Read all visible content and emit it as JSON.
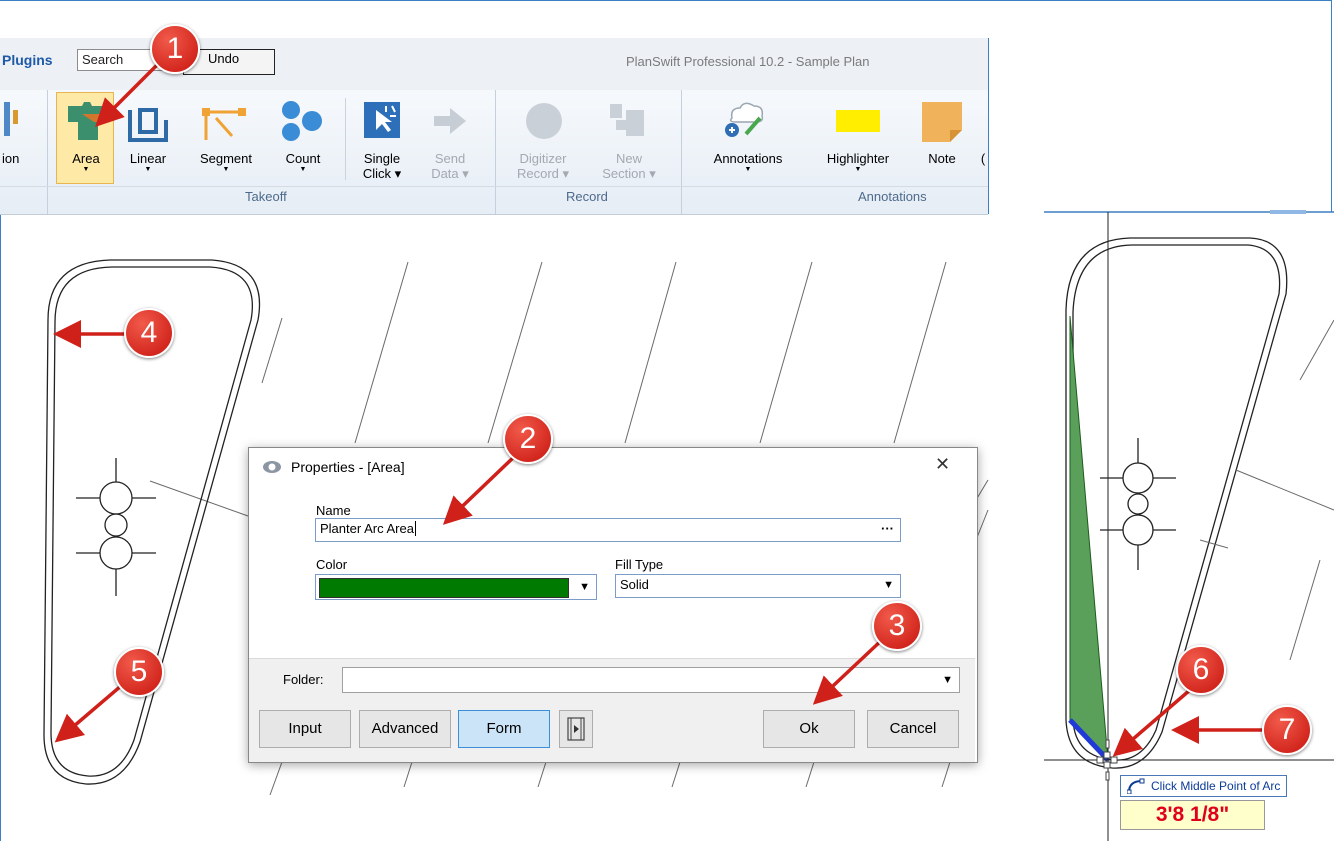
{
  "ribbon": {
    "tab_label": "Plugins",
    "search_placeholder": "Search",
    "undo_label": "Undo",
    "app_title": "PlanSwift Professional 10.2 - Sample Plan",
    "partial_label": "ion",
    "takeoff_group": "Takeoff",
    "record_group": "Record",
    "annotations_group": "Annotations",
    "buttons": {
      "area": "Area",
      "linear": "Linear",
      "segment": "Segment",
      "count": "Count",
      "single_click_1": "Single",
      "single_click_2": "Click",
      "send_data_1": "Send",
      "send_data_2": "Data",
      "digitizer_1": "Digitizer",
      "digitizer_2": "Record",
      "new_section_1": "New",
      "new_section_2": "Section",
      "annotations": "Annotations",
      "highlighter": "Highlighter",
      "note": "Note"
    }
  },
  "dialog": {
    "title": "Properties - [Area]",
    "name_label": "Name",
    "name_value": "Planter Arc Area",
    "color_label": "Color",
    "color_value": "#007a00",
    "fill_type_label": "Fill Type",
    "fill_type_value": "Solid",
    "folder_label": "Folder:",
    "folder_value": "",
    "buttons": {
      "input": "Input",
      "advanced": "Advanced",
      "form": "Form",
      "ok": "Ok",
      "cancel": "Cancel"
    }
  },
  "callouts": [
    "1",
    "2",
    "3",
    "4",
    "5",
    "6",
    "7"
  ],
  "tooltip": {
    "prompt": "Click Middle Point of Arc",
    "measurement": "3'8 1/8\""
  },
  "colors": {
    "accent": "#3b7fc4",
    "callout_red": "#d0201a",
    "area_fill": "#5aa05a",
    "segment_blue": "#1f3ad6"
  },
  "icons": [
    "area-icon",
    "linear-icon",
    "segment-icon",
    "count-icon",
    "single-click-icon",
    "send-data-icon",
    "digitizer-icon",
    "new-section-icon",
    "annotations-icon",
    "highlighter-icon",
    "note-icon",
    "eye-icon",
    "close-icon",
    "ellipsis-icon",
    "chevron-down-icon",
    "media-icon",
    "arc-tool-icon"
  ]
}
